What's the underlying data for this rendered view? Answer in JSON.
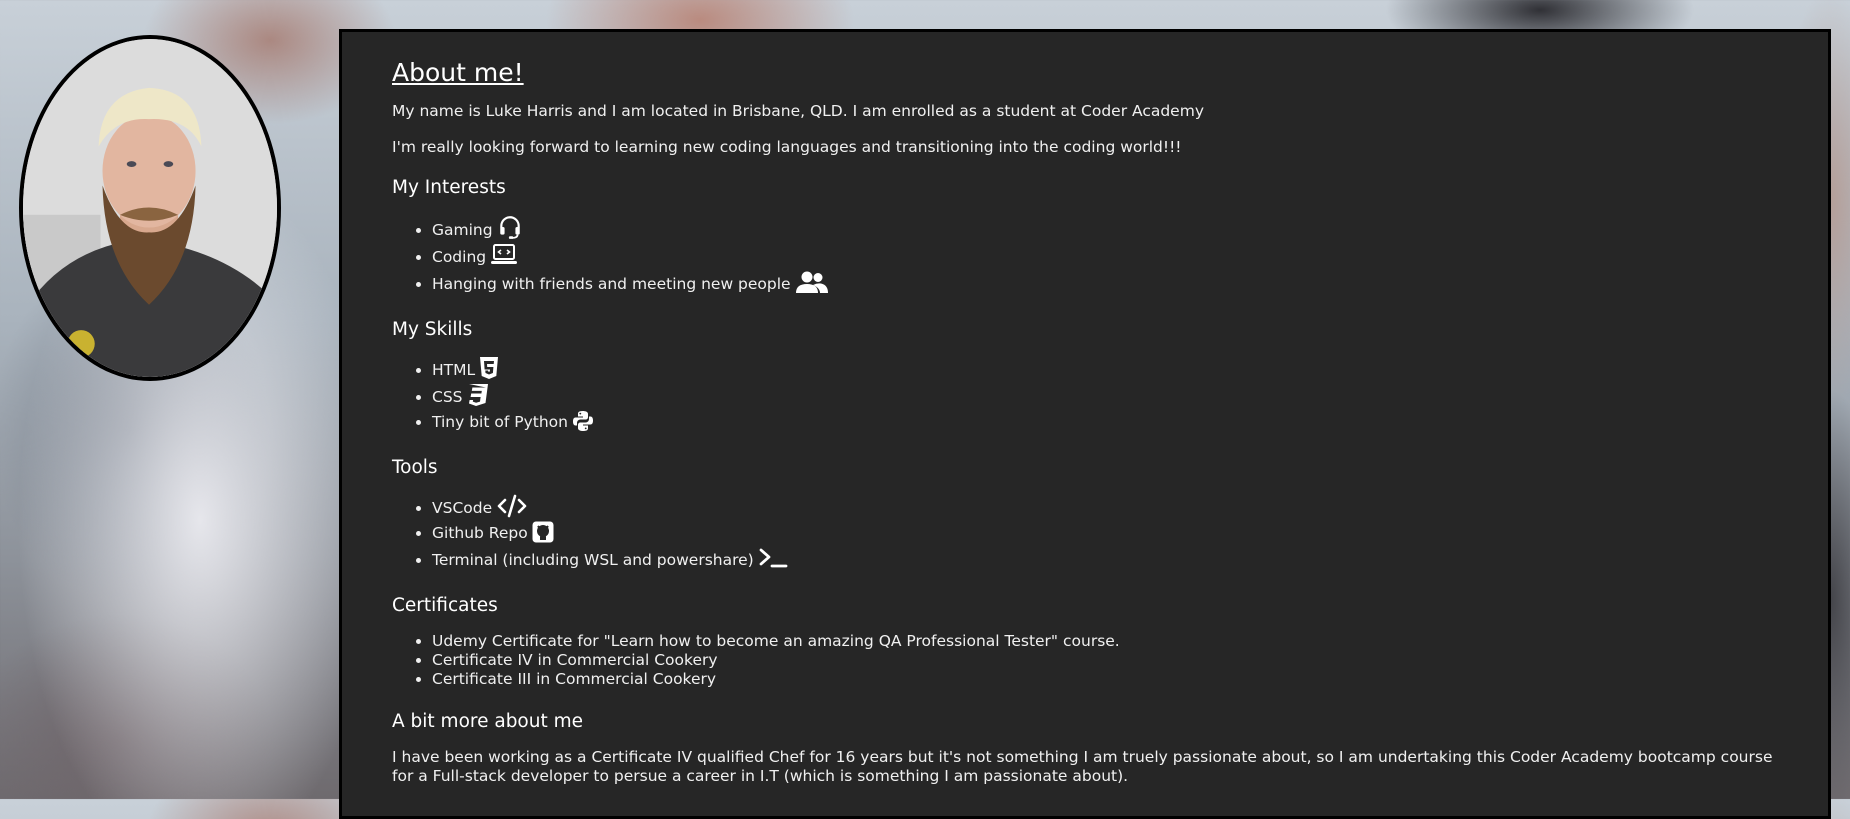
{
  "profile": {
    "photo_alt": "Profile photo"
  },
  "about": {
    "title": "About me!",
    "intro": "My name is Luke Harris and I am located in Brisbane, QLD. I am enrolled as a student at Coder Academy",
    "forward": "I'm really looking forward to learning new coding languages and transitioning into the coding world!!!"
  },
  "interests": {
    "heading": "My Interests",
    "items": [
      {
        "label": "Gaming",
        "icon": "headset-icon"
      },
      {
        "label": "Coding",
        "icon": "laptop-code-icon"
      },
      {
        "label": "Hanging with friends and meeting new people",
        "icon": "user-group-icon"
      }
    ]
  },
  "skills": {
    "heading": "My Skills",
    "items": [
      {
        "label": "HTML",
        "icon": "html5-icon"
      },
      {
        "label": "CSS",
        "icon": "css3-icon"
      },
      {
        "label": "Tiny bit of Python",
        "icon": "python-icon"
      }
    ]
  },
  "tools": {
    "heading": "Tools",
    "items": [
      {
        "label": "VSCode",
        "icon": "code-icon"
      },
      {
        "label": "Github Repo",
        "icon": "github-icon"
      },
      {
        "label": "Terminal (including WSL and powershare)",
        "icon": "terminal-icon"
      }
    ]
  },
  "certificates": {
    "heading": "Certificates",
    "items": [
      "Udemy Certificate for \"Learn how to become an amazing QA Professional Tester\" course.",
      "Certificate IV in Commercial Cookery",
      "Certificate III in Commercial Cookery"
    ]
  },
  "more": {
    "heading": "A bit more about me",
    "text": "I have been working as a Certificate IV qualified Chef for 16 years but it's not something I am truely passionate about, so I am undertaking this Coder Academy bootcamp course for a Full-stack developer to persue a career in I.T (which is something I am passionate about)."
  },
  "colors": {
    "panel_bg": "#262626",
    "text": "#f0f0f0",
    "frame_border": "#000000"
  }
}
